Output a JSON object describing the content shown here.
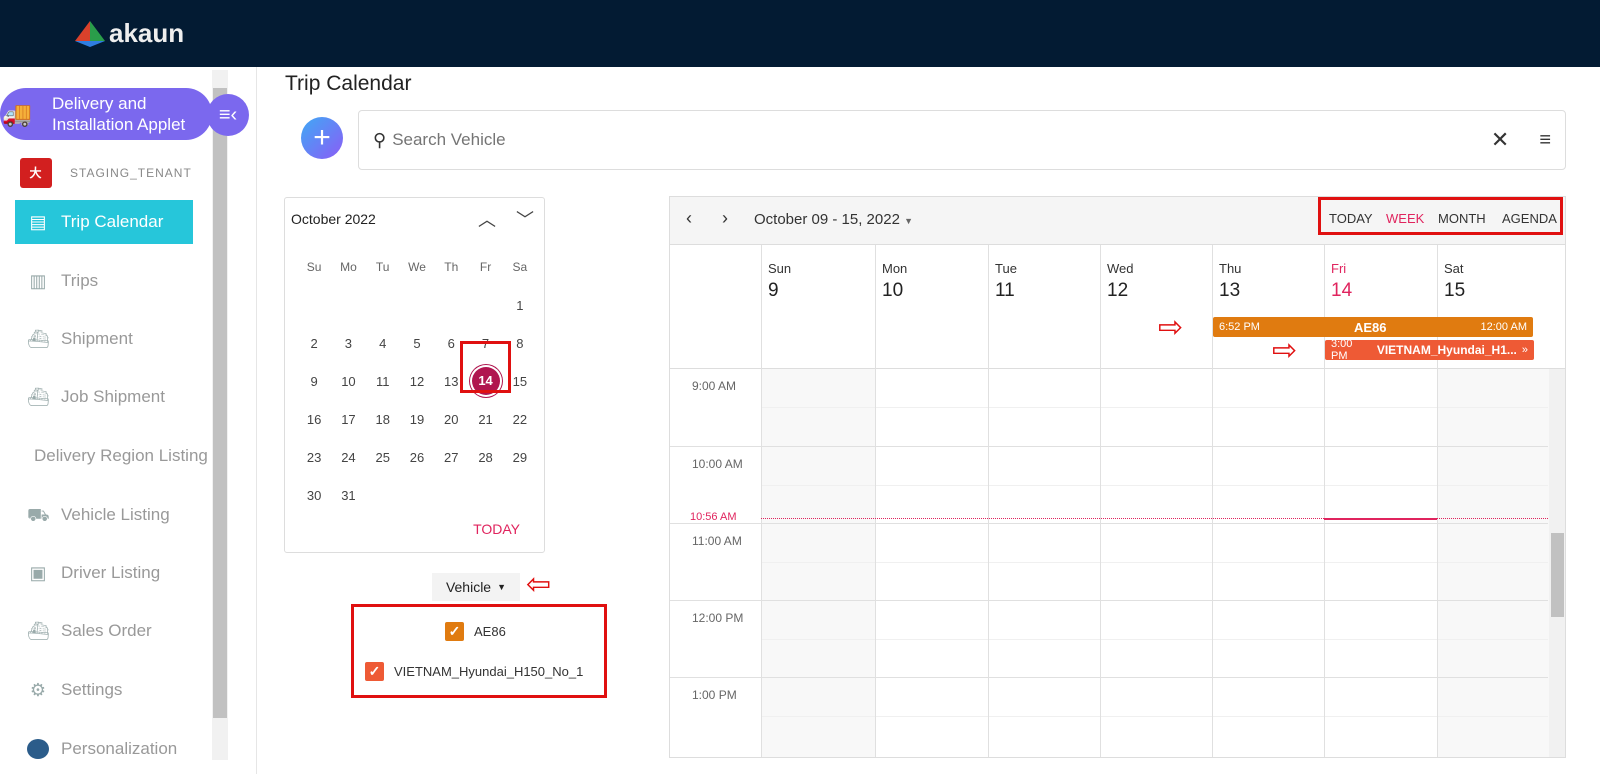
{
  "header": {
    "logo_text": "akaun"
  },
  "sidebar": {
    "applet_title": "Delivery and Installation Applet",
    "tenant": "STAGING_TENANT",
    "items": [
      {
        "label": "Trip Calendar",
        "icon": "calendar-icon",
        "active": true
      },
      {
        "label": "Trips",
        "icon": "map-icon"
      },
      {
        "label": "Shipment",
        "icon": "ship-icon"
      },
      {
        "label": "Job Shipment",
        "icon": "ship-icon"
      },
      {
        "label": "Delivery Region Listing",
        "icon": ""
      },
      {
        "label": "Vehicle Listing",
        "icon": "truck-icon"
      },
      {
        "label": "Driver Listing",
        "icon": "badge-icon"
      },
      {
        "label": "Sales Order",
        "icon": "ship-icon"
      },
      {
        "label": "Settings",
        "icon": "gear-icon"
      },
      {
        "label": "Personalization",
        "icon": "avatar-icon"
      }
    ]
  },
  "page": {
    "title": "Trip Calendar"
  },
  "search": {
    "placeholder": "Search Vehicle"
  },
  "mini_calendar": {
    "month": "October 2022",
    "weekdays": [
      "Su",
      "Mo",
      "Tu",
      "We",
      "Th",
      "Fr",
      "Sa"
    ],
    "weeks": [
      [
        "",
        "",
        "",
        "",
        "",
        "",
        "1"
      ],
      [
        "2",
        "3",
        "4",
        "5",
        "6",
        "7",
        "8"
      ],
      [
        "9",
        "10",
        "11",
        "12",
        "13",
        "14",
        "15"
      ],
      [
        "16",
        "17",
        "18",
        "19",
        "20",
        "21",
        "22"
      ],
      [
        "23",
        "24",
        "25",
        "26",
        "27",
        "28",
        "29"
      ],
      [
        "30",
        "31",
        "",
        "",
        "",
        "",
        ""
      ]
    ],
    "selected": "14",
    "today_label": "TODAY"
  },
  "filter": {
    "dropdown_label": "Vehicle",
    "vehicles": [
      {
        "name": "AE86",
        "color": "#e07b10",
        "checked": true
      },
      {
        "name": "VIETNAM_Hyundai_H150_No_1",
        "color": "#ee5a35",
        "checked": true
      }
    ]
  },
  "calendar": {
    "range": "October 09 - 15, 2022",
    "views": [
      "TODAY",
      "WEEK",
      "MONTH",
      "AGENDA"
    ],
    "active_view": "WEEK",
    "days": [
      {
        "name": "Sun",
        "num": "9"
      },
      {
        "name": "Mon",
        "num": "10"
      },
      {
        "name": "Tue",
        "num": "11"
      },
      {
        "name": "Wed",
        "num": "12"
      },
      {
        "name": "Thu",
        "num": "13"
      },
      {
        "name": "Fri",
        "num": "14",
        "today": true
      },
      {
        "name": "Sat",
        "num": "15"
      }
    ],
    "events": [
      {
        "start": "6:52 PM",
        "title": "AE86",
        "end": "12:00 AM",
        "color": "#e07b10"
      },
      {
        "start": "3:00 PM",
        "title": "VIETNAM_Hyundai_H1...",
        "end": "»",
        "color": "#ee5a35"
      }
    ],
    "hours": [
      "9:00 AM",
      "10:00 AM",
      "11:00 AM",
      "12:00 PM",
      "1:00 PM"
    ],
    "current_time": "10:56 AM"
  }
}
